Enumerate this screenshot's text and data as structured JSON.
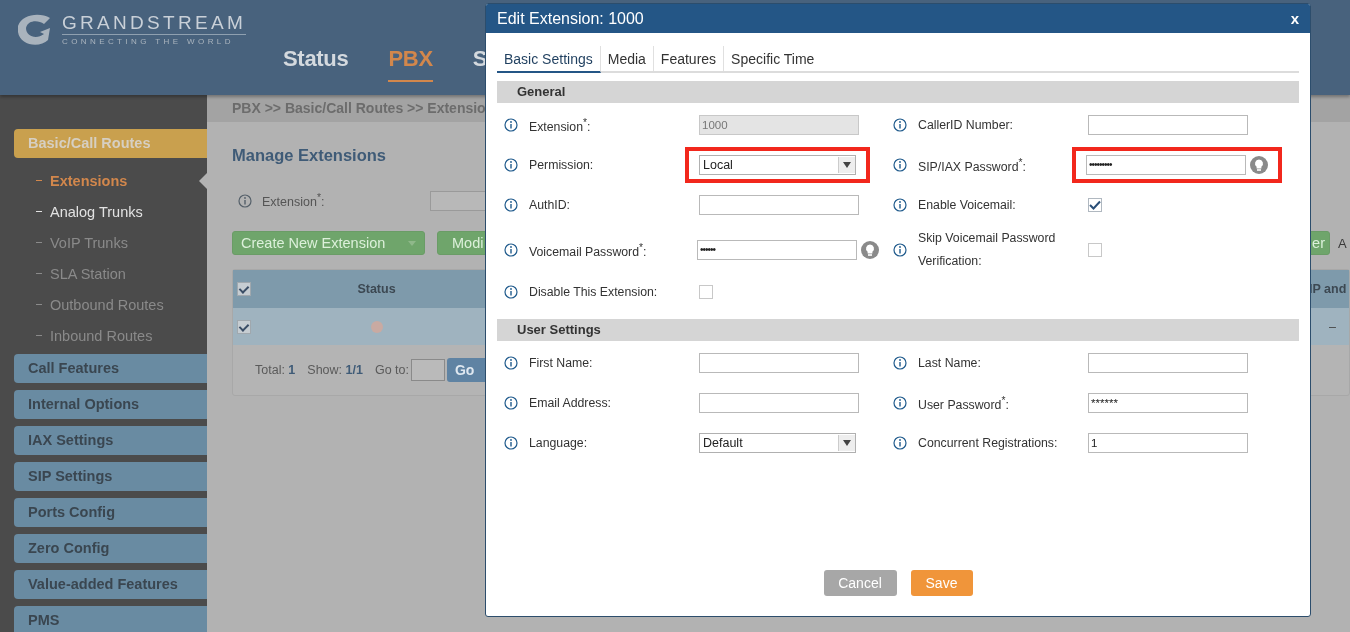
{
  "header": {
    "logo_name": "GRANDSTREAM",
    "logo_tagline": "CONNECTING THE WORLD",
    "nav": [
      {
        "label": "Status",
        "selected": false
      },
      {
        "label": "PBX",
        "selected": true
      },
      {
        "label": "S",
        "selected": false
      }
    ]
  },
  "sidebar": {
    "groups": [
      {
        "label": "Basic/Call Routes",
        "selected": true,
        "children": [
          {
            "label": "Extensions",
            "selected": true,
            "hovered": false
          },
          {
            "label": "Analog Trunks",
            "selected": false,
            "hovered": true
          },
          {
            "label": "VoIP Trunks",
            "selected": false,
            "hovered": false
          },
          {
            "label": "SLA Station",
            "selected": false,
            "hovered": false
          },
          {
            "label": "Outbound Routes",
            "selected": false,
            "hovered": false
          },
          {
            "label": "Inbound Routes",
            "selected": false,
            "hovered": false
          }
        ]
      },
      {
        "label": "Call Features",
        "selected": false
      },
      {
        "label": "Internal Options",
        "selected": false
      },
      {
        "label": "IAX Settings",
        "selected": false
      },
      {
        "label": "SIP Settings",
        "selected": false
      },
      {
        "label": "Ports Config",
        "selected": false
      },
      {
        "label": "Zero Config",
        "selected": false
      },
      {
        "label": "Value-added Features",
        "selected": false
      },
      {
        "label": "PMS",
        "selected": false
      }
    ]
  },
  "breadcrumb": "PBX >> Basic/Call Routes >> Extensio",
  "main": {
    "title": "Manage Extensions",
    "search_label": "Extension$^{*}$:",
    "buttons": [
      {
        "label": "Create New Extension",
        "dropdown": true
      },
      {
        "label": "Modi",
        "dropdown": false
      }
    ],
    "right_button": "er",
    "right_text": "A",
    "table": {
      "header_checked": true,
      "columns": [
        "Status",
        "IP and"
      ],
      "rows": [
        {
          "checked": true,
          "color": "#c9aaa2",
          "column_2": "–"
        }
      ]
    },
    "footer": {
      "total_label": "Total:",
      "total": "1",
      "show_label": "Show:",
      "show": "1/1",
      "goto_label": "Go to:",
      "go_button": "Go"
    }
  },
  "dialog": {
    "title": "Edit Extension: 1000",
    "close": "x",
    "tabs": [
      {
        "label": "Basic Settings",
        "selected": true
      },
      {
        "label": "Media",
        "selected": false
      },
      {
        "label": "Features",
        "selected": false
      },
      {
        "label": "Specific Time",
        "selected": false
      }
    ],
    "sections": [
      {
        "title": "General",
        "rows": [
          [
            {
              "label": "Extension$^{*}$:",
              "kind": "text",
              "value": "1000",
              "disabled": true
            },
            {
              "label": "CallerID Number:",
              "kind": "text",
              "disabled": false
            }
          ],
          [
            {
              "label": "Permission:",
              "kind": "select",
              "value": "Local",
              "highlighted": true
            },
            {
              "label": "SIP/IAX Password$^{*}$:",
              "kind": "password",
              "value": "•••••••••",
              "disabled": false,
              "highlighted": true
            }
          ],
          [
            {
              "label": "AuthID:",
              "kind": "text",
              "disabled": false
            },
            {
              "label": "Enable Voicemail:",
              "kind": "checkbox",
              "checked": true
            }
          ],
          [
            {
              "label": "Voicemail Password$^{*}$:",
              "kind": "password",
              "value": "••••••",
              "disabled": false
            },
            {
              "label": "Skip Voicemail Password Verification:",
              "kind": "checkbox",
              "checked": false
            }
          ],
          [
            {
              "label": "Disable This Extension:",
              "kind": "checkbox",
              "checked": false
            }
          ]
        ]
      },
      {
        "title": "User Settings",
        "rows": [
          [
            {
              "label": "First Name:",
              "kind": "text",
              "disabled": false
            },
            {
              "label": "Last Name:",
              "kind": "text",
              "disabled": false
            }
          ],
          [
            {
              "label": "Email Address:",
              "kind": "text",
              "disabled": false
            },
            {
              "label": "User Password$^{*}$:",
              "kind": "text",
              "value": "******",
              "disabled": false
            }
          ],
          [
            {
              "label": "Language:",
              "kind": "select",
              "value": "Default"
            },
            {
              "label": "Concurrent Registrations:",
              "kind": "text",
              "value": "1",
              "disabled": false
            }
          ]
        ]
      }
    ],
    "buttons": [
      {
        "label": "Cancel",
        "kind": "secondary"
      },
      {
        "label": "Save",
        "kind": "primary"
      }
    ]
  }
}
